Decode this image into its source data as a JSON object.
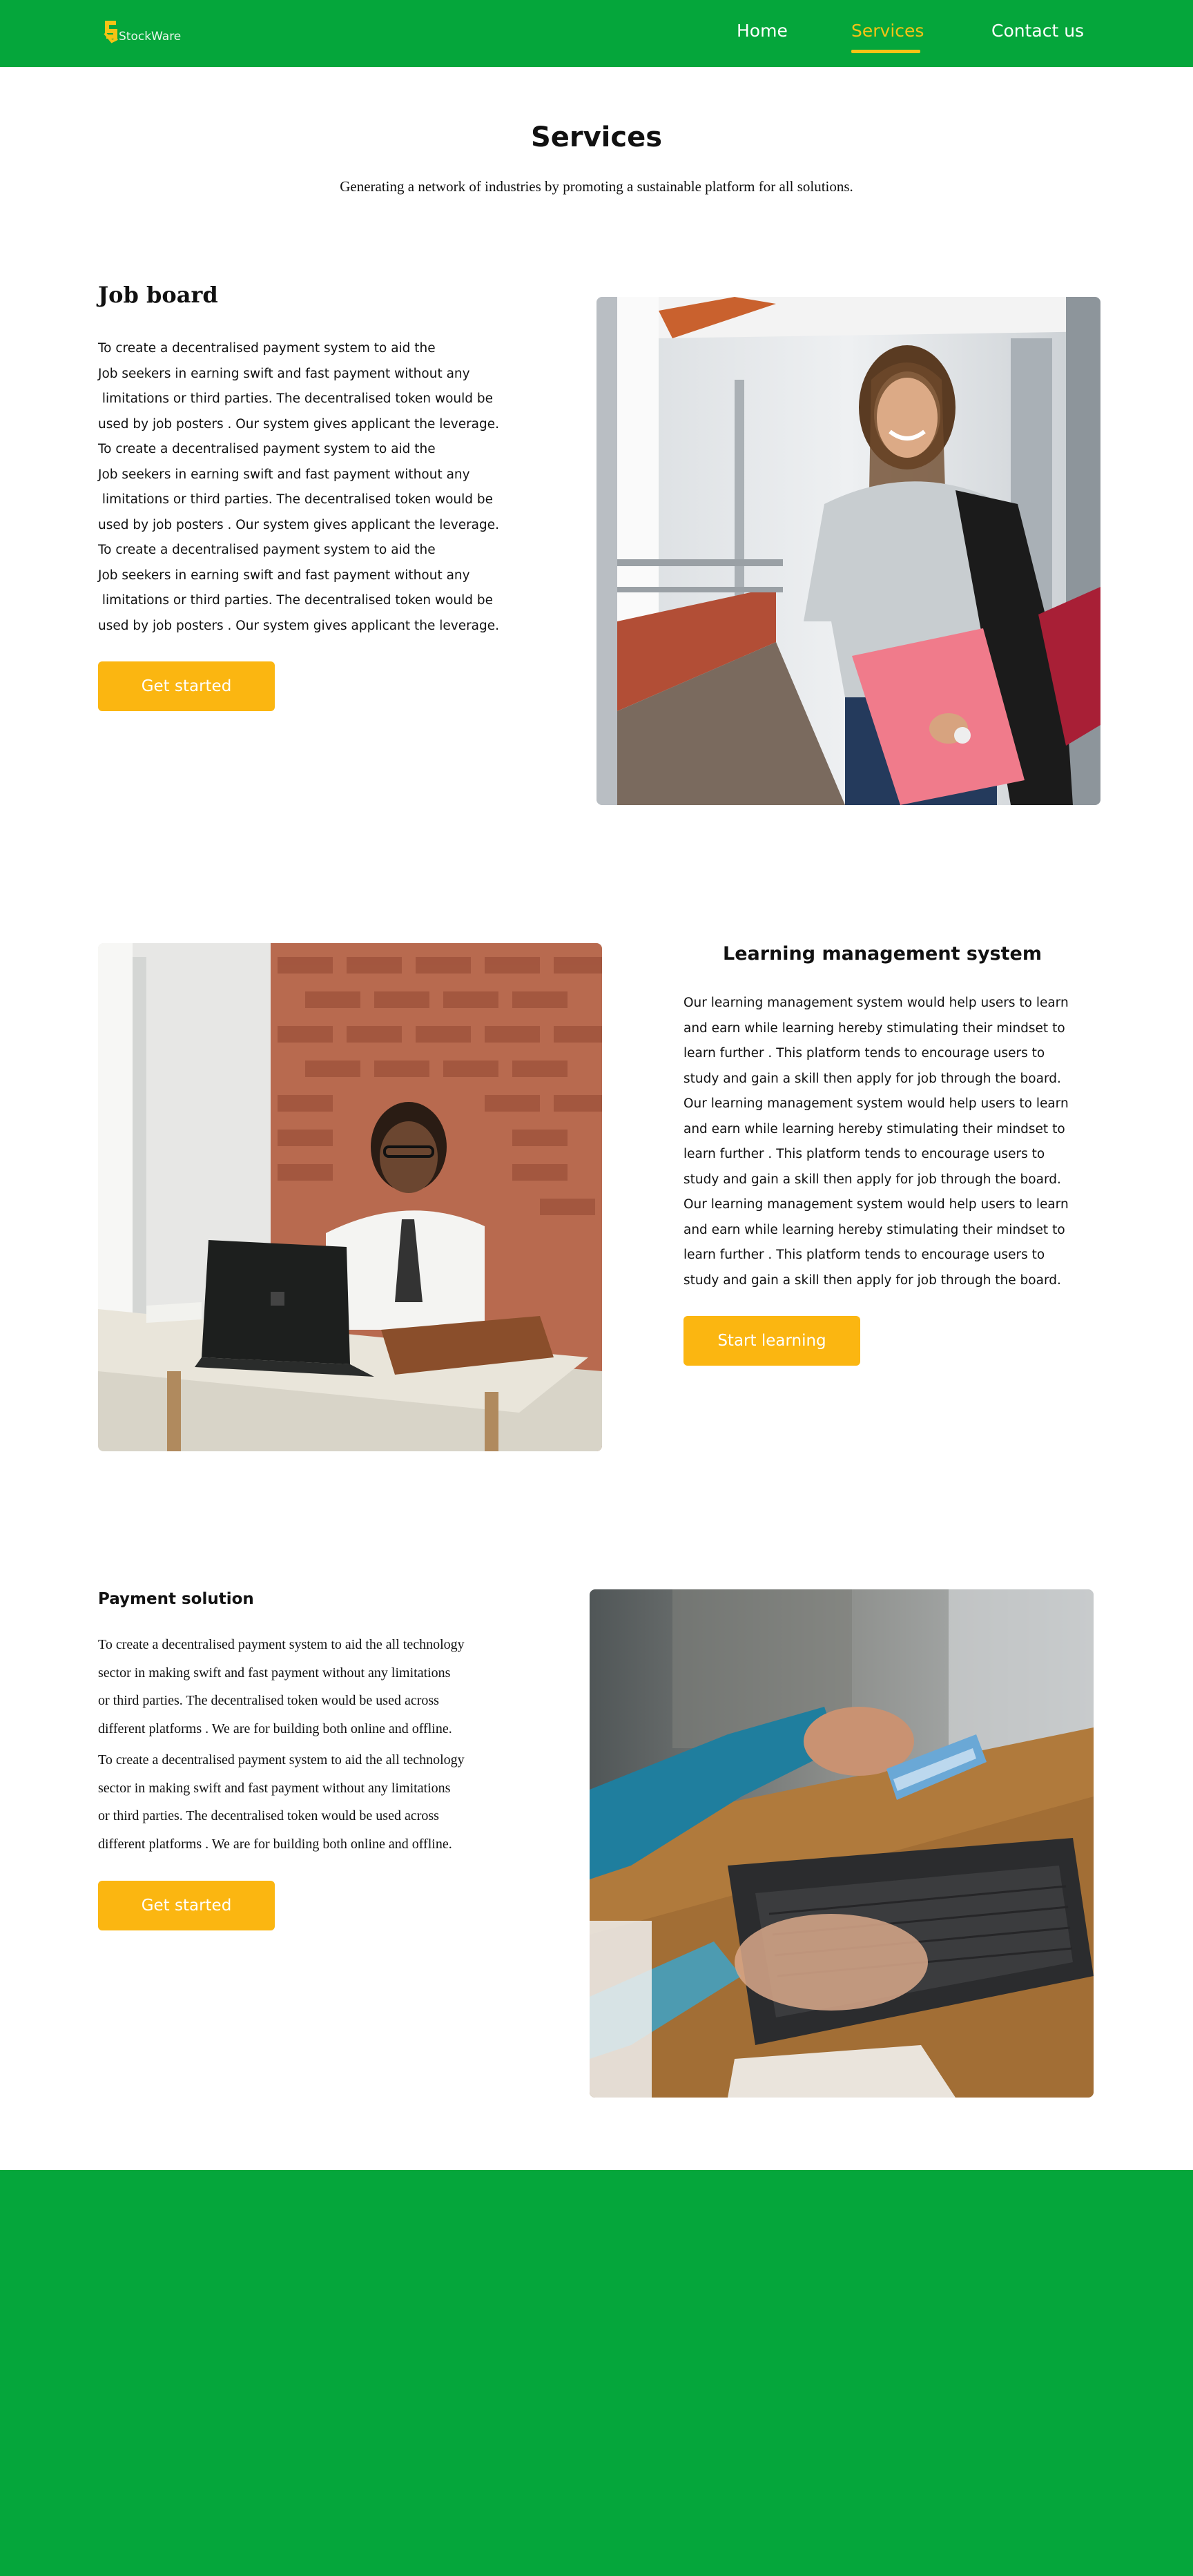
{
  "brand": {
    "name": "StockWare",
    "accent": "#f6c315",
    "primary_green": "#05a63b",
    "button_color": "#fbb611"
  },
  "nav": {
    "items": [
      "Home",
      "Services",
      "Contact us"
    ],
    "active": "Services"
  },
  "header": {
    "title": "Services",
    "subtitle": "Generating a network of industries by promoting a sustainable platform for all solutions."
  },
  "sections": [
    {
      "title": "Job board",
      "lines": [
        "To create a decentralised payment system to aid the",
        "Job seekers in earning swift and fast payment without any",
        " limitations or third parties. The decentralised token would be",
        "used by job posters . Our system gives applicant the leverage.",
        "To create a decentralised payment system to aid the",
        "Job seekers in earning swift and fast payment without any",
        " limitations or third parties. The decentralised token would be",
        "used by job posters . Our system gives applicant the leverage.",
        "To create a decentralised payment system to aid the",
        "Job seekers in earning swift and fast payment without any",
        " limitations or third parties. The decentralised token would be",
        "used by job posters . Our system gives applicant the leverage."
      ],
      "button": "Get started",
      "image_icon": "student-photo"
    },
    {
      "title": "Learning management system",
      "lines": [
        "Our learning management system would help users to learn",
        "and earn while learning hereby stimulating their mindset to",
        "learn further . This platform tends to encourage users to",
        "study and gain a skill then apply for job through the board.",
        "Our learning management system would help users to learn",
        "and earn while learning hereby stimulating their mindset to",
        "learn further . This platform tends to encourage users to",
        "study and gain a skill then apply for job through the board.",
        "Our learning management system would help users to learn",
        "and earn while learning hereby stimulating their mindset to",
        "learn further . This platform tends to encourage users to",
        "study and gain a skill then apply for job through the board."
      ],
      "button": "Start learning",
      "image_icon": "laptop-learner-photo"
    },
    {
      "title": "Payment solution",
      "lines": [
        "To create a decentralised payment system to aid the all technology",
        "sector in making swift and fast payment without any limitations",
        "or third parties. The decentralised token would be used across",
        "different platforms . We are for building both online and offline.",
        "To create a decentralised payment system to aid the all technology",
        "sector in making swift and fast payment without any limitations",
        "or third parties. The decentralised token would be used across",
        "different platforms . We are for building both online and offline."
      ],
      "button": "Get started",
      "image_icon": "card-payment-photo"
    }
  ]
}
